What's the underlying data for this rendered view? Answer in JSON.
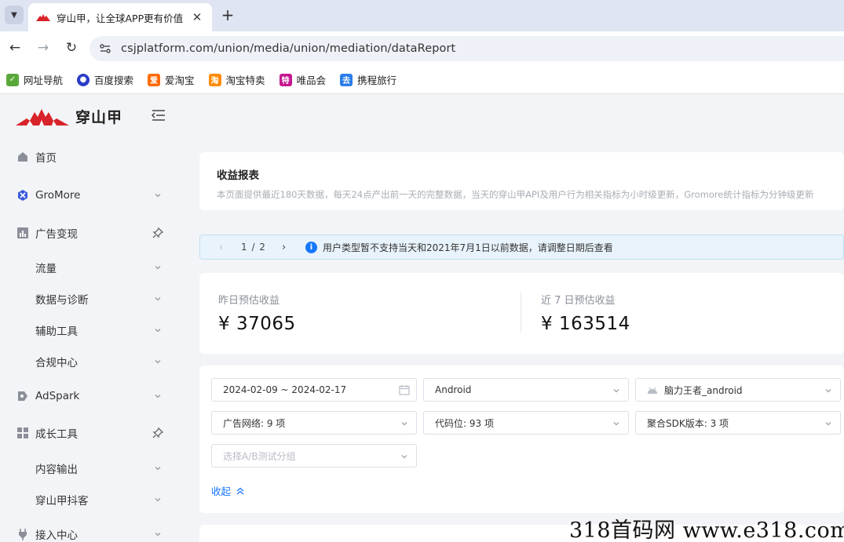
{
  "browser": {
    "tab": {
      "title": "穿山甲，让全球APP更有价值",
      "close_glyph": "✕"
    },
    "new_tab_glyph": "+",
    "nav": {
      "back": "←",
      "forward": "→",
      "reload": "↻"
    },
    "url": "csjplatform.com/union/media/union/mediation/dataReport",
    "bookmarks": [
      {
        "label": "网址导航",
        "icon": "hao-icon",
        "color": "#5aa83a"
      },
      {
        "label": "百度搜索",
        "icon": "baidu-paw-icon",
        "color": "#2a3cc7"
      },
      {
        "label": "爱淘宝",
        "icon": "aitaobao-icon",
        "color": "#ff6a00"
      },
      {
        "label": "淘宝特卖",
        "icon": "taobao-icon",
        "color": "#ff8a00"
      },
      {
        "label": "唯品会",
        "icon": "vip-icon",
        "color": "#c6168d"
      },
      {
        "label": "携程旅行",
        "icon": "ctrip-icon",
        "color": "#2b7de9"
      }
    ]
  },
  "brand": {
    "name": "穿山甲",
    "accent": "#d8232a"
  },
  "sidebar": {
    "items": [
      {
        "label": "首页",
        "icon": "home-icon"
      },
      {
        "label": "GroMore",
        "icon": "gromore-icon",
        "chevron": true
      },
      {
        "label": "广告变现",
        "icon": "bar-chart-icon",
        "pin": true
      },
      {
        "label": "流量",
        "chevron": true
      },
      {
        "label": "数据与诊断",
        "chevron": true
      },
      {
        "label": "辅助工具",
        "chevron": true
      },
      {
        "label": "合规中心",
        "chevron": true
      },
      {
        "label": "AdSpark",
        "icon": "adspark-icon",
        "chevron": true
      },
      {
        "label": "成长工具",
        "icon": "grid-icon",
        "pin": true
      },
      {
        "label": "内容输出",
        "chevron": true
      },
      {
        "label": "穿山甲抖客",
        "chevron": true
      },
      {
        "label": "接入中心",
        "icon": "plug-icon",
        "chevron": true
      }
    ]
  },
  "header": {
    "title": "收益报表",
    "description": "本页面提供最近180天数据，每天24点产出前一天的完整数据，当天的穿山甲API及用户行为相关指标为小时级更新，Gromore统计指标为分钟级更新"
  },
  "notice": {
    "prev": "‹",
    "pager": "1 / 2",
    "next": "›",
    "text": "用户类型暂不支持当天和2021年7月1日以前数据，请调整日期后查看"
  },
  "stats": [
    {
      "label": "昨日预估收益",
      "value": "¥ 37065"
    },
    {
      "label": "近 7 日预估收益",
      "value": "¥ 163514"
    }
  ],
  "filters": {
    "date_range": "2024-02-09 ~ 2024-02-17",
    "platform": "Android",
    "app": "脑力王者_android",
    "ad_network": "广告网络: 9 项",
    "ad_slot": "代码位: 93 项",
    "sdk_version": "聚合SDK版本: 3 项",
    "ab_group_placeholder": "选择A/B测试分组",
    "collapse_label": "收起"
  },
  "watermark": "318首码网 www.e318.com"
}
